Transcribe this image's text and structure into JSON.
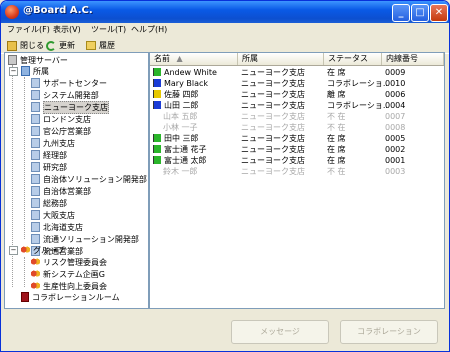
{
  "window": {
    "title": "@Board A.C.",
    "min_label": "_",
    "max_label": "□",
    "close_label": "✕"
  },
  "menu": [
    "ファイル(F)",
    "表示(V)",
    "ツール(T)",
    "ヘルプ(H)"
  ],
  "toolbar": {
    "close": "閉じる",
    "refresh": "更新",
    "history": "履歴"
  },
  "tree": {
    "root": "管理サーバー",
    "org": "所属",
    "org_items": [
      "サポートセンター",
      "システム開発部",
      "ニューヨーク支店",
      "ロンドン支店",
      "官公庁営業部",
      "九州支店",
      "経理部",
      "研究部",
      "自治体ソリューション開発部",
      "自治体営業部",
      "総務部",
      "大阪支店",
      "北海道支店",
      "流通ソリューション開発部",
      "流通営業部"
    ],
    "selected": "ニューヨーク支店",
    "group": "グループ",
    "group_items": [
      "リスク管理委員会",
      "新システム企画G",
      "生産性向上委員会"
    ],
    "room": "コラボレーションルーム"
  },
  "list": {
    "columns": [
      "名前",
      "所属",
      "ステータス",
      "内線番号"
    ],
    "rows": [
      {
        "name": "Andew White",
        "dept": "ニューヨーク支店",
        "status": "在 席",
        "ext": "0009",
        "flag": "#2ab52a",
        "dim": false
      },
      {
        "name": "Mary Black",
        "dept": "ニューヨーク支店",
        "status": "コラボレーショ..",
        "ext": "0010",
        "flag": "#1a3bd6",
        "dim": false
      },
      {
        "name": "佐藤 四郎",
        "dept": "ニューヨーク支店",
        "status": "離 席",
        "ext": "0006",
        "flag": "#e6c800",
        "dim": false
      },
      {
        "name": "山田 二郎",
        "dept": "ニューヨーク支店",
        "status": "コラボレーショ..",
        "ext": "0004",
        "flag": "#1a3bd6",
        "dim": false
      },
      {
        "name": "山本 五郎",
        "dept": "ニューヨーク支店",
        "status": "不 在",
        "ext": "0007",
        "flag": "",
        "dim": true
      },
      {
        "name": "小林 一子",
        "dept": "ニューヨーク支店",
        "status": "不 在",
        "ext": "0008",
        "flag": "",
        "dim": true
      },
      {
        "name": "田中 三郎",
        "dept": "ニューヨーク支店",
        "status": "在 席",
        "ext": "0005",
        "flag": "#2ab52a",
        "dim": false
      },
      {
        "name": "富士通 花子",
        "dept": "ニューヨーク支店",
        "status": "在 席",
        "ext": "0002",
        "flag": "#2ab52a",
        "dim": false
      },
      {
        "name": "富士通 太郎",
        "dept": "ニューヨーク支店",
        "status": "在 席",
        "ext": "0001",
        "flag": "#2ab52a",
        "dim": false
      },
      {
        "name": "鈴木 一郎",
        "dept": "ニューヨーク支店",
        "status": "不 在",
        "ext": "0003",
        "flag": "",
        "dim": true
      }
    ]
  },
  "buttons": {
    "message": "メッセージ",
    "collab": "コラボレーション"
  }
}
